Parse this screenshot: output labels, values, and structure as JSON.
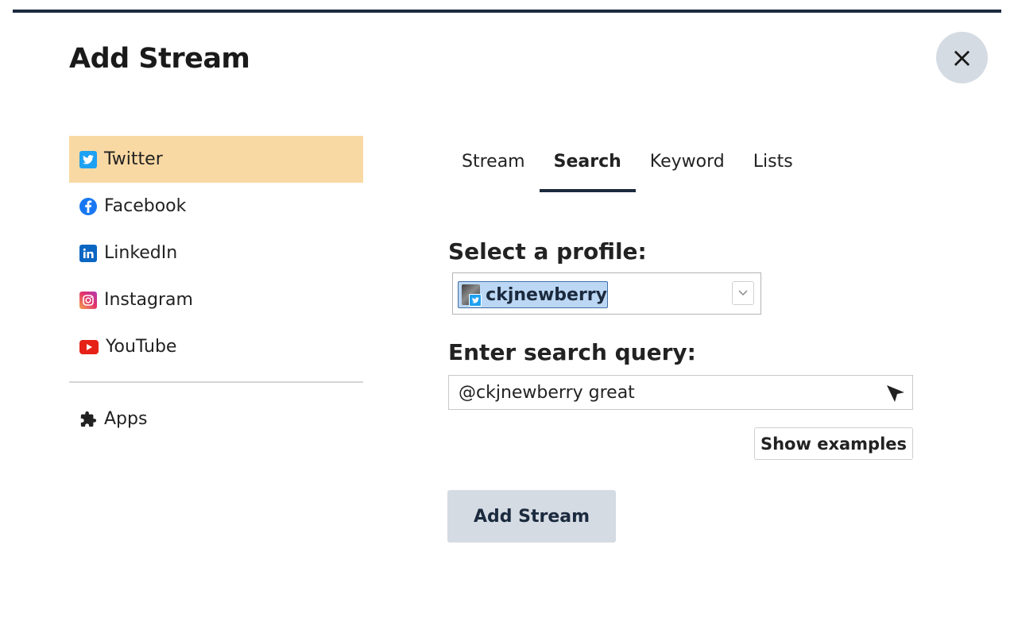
{
  "dialog": {
    "title": "Add Stream",
    "close_glyph": "×"
  },
  "sidebar": {
    "items": [
      {
        "label": "Twitter",
        "icon": "twitter-icon",
        "active": true
      },
      {
        "label": "Facebook",
        "icon": "facebook-icon",
        "active": false
      },
      {
        "label": "LinkedIn",
        "icon": "linkedin-icon",
        "active": false
      },
      {
        "label": "Instagram",
        "icon": "instagram-icon",
        "active": false
      },
      {
        "label": "YouTube",
        "icon": "youtube-icon",
        "active": false
      }
    ],
    "apps_label": "Apps",
    "active_color": "#f9d9a3"
  },
  "tabs": [
    {
      "label": "Stream",
      "active": false
    },
    {
      "label": "Search",
      "active": true
    },
    {
      "label": "Keyword",
      "active": false
    },
    {
      "label": "Lists",
      "active": false
    }
  ],
  "form": {
    "profile_label": "Select a profile:",
    "profile_selected": "ckjnewberry",
    "query_label": "Enter search query:",
    "query_value": "@ckjnewberry great",
    "show_examples_label": "Show examples",
    "add_stream_label": "Add Stream"
  },
  "colors": {
    "accent": "#1b2a3e",
    "button_bg": "#d5dbe3",
    "chip_bg": "#bcd7f3"
  }
}
